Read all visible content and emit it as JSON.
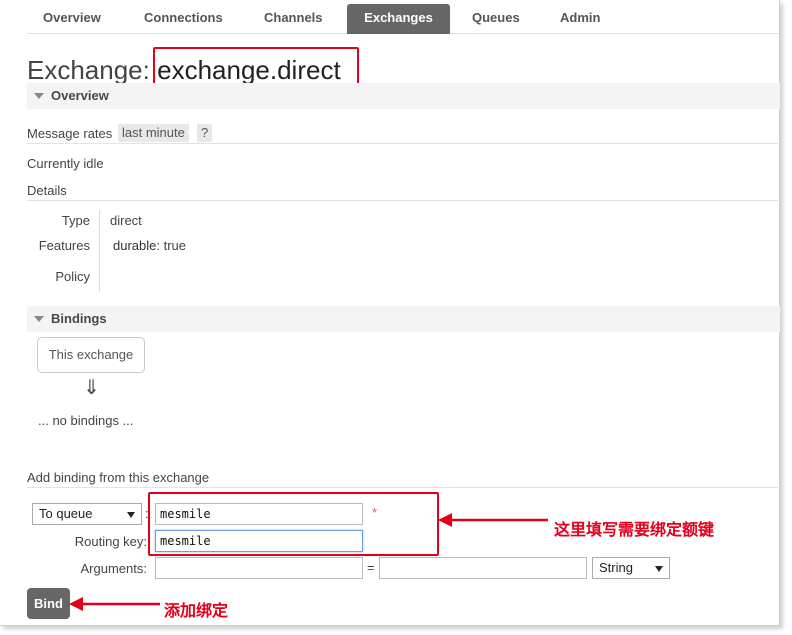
{
  "nav": {
    "tabs": [
      {
        "label": "Overview"
      },
      {
        "label": "Connections"
      },
      {
        "label": "Channels"
      },
      {
        "label": "Exchanges"
      },
      {
        "label": "Queues"
      },
      {
        "label": "Admin"
      }
    ],
    "active_tab": "Exchanges"
  },
  "page": {
    "title_prefix": "Exchange:",
    "exchange_name": "exchange.direct"
  },
  "overview": {
    "heading": "Overview",
    "message_rates_label": "Message rates",
    "message_rates_period": "last minute",
    "help": "?",
    "status": "Currently idle",
    "details_heading": "Details",
    "type_label": "Type",
    "type_value": "direct",
    "features_label": "Features",
    "features_key": "durable:",
    "features_value": "true",
    "policy_label": "Policy"
  },
  "bindings": {
    "heading": "Bindings",
    "this_exchange": "This exchange",
    "arrow": "⇓",
    "none": "... no bindings ..."
  },
  "add_binding": {
    "heading": "Add binding from this exchange",
    "destination_type": "To queue",
    "colon": ":",
    "destination_value": "mesmile",
    "required_mark": "*",
    "routing_key_label": "Routing key:",
    "routing_key_value": "mesmile",
    "arguments_label": "Arguments:",
    "equals": "=",
    "argument_type": "String",
    "bind_button": "Bind"
  },
  "annotations": {
    "fill_key_note": "这里填写需要绑定额键",
    "add_binding_note": "添加绑定"
  },
  "colors": {
    "active_tab_bg": "#666666",
    "highlight_red": "#e3001b",
    "section_bg": "#f4f4f4"
  }
}
